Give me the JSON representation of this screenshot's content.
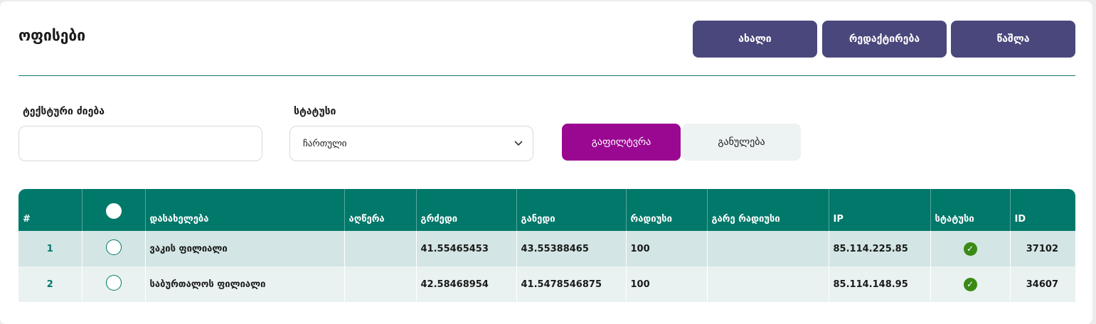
{
  "page": {
    "title": "ოფისები"
  },
  "toolbar": {
    "new_label": "ახალი",
    "edit_label": "რედაქტირება",
    "delete_label": "წაშლა"
  },
  "filters": {
    "search_label": "ტექსტური ძიება",
    "search_value": "",
    "status_label": "სტატუსი",
    "status_selected": "ჩართული",
    "filter_label": "გაფილტვრა",
    "reset_label": "განულება"
  },
  "table": {
    "columns": [
      "#",
      "",
      "დასახელება",
      "აღწერა",
      "გრძედი",
      "განედი",
      "რადიუსი",
      "გარე რადიუსი",
      "IP",
      "სტატუსი",
      "ID"
    ],
    "rows": [
      {
        "num": "1",
        "name": "ვაკის ფილიალი",
        "description": "",
        "longitude": "41.55465453",
        "latitude": "43.55388465",
        "radius": "100",
        "outer_radius": "",
        "ip": "85.114.225.85",
        "status": "active",
        "id": "37102"
      },
      {
        "num": "2",
        "name": "საბურთალოს ფილიალი",
        "description": "",
        "longitude": "42.58468954",
        "latitude": "41.5478546875",
        "radius": "100",
        "outer_radius": "",
        "ip": "85.114.148.95",
        "status": "active",
        "id": "34607"
      }
    ]
  },
  "icons": {
    "select_arrow": "chevron-down-icon",
    "status_active": "check-circle-icon",
    "row_select": "radio-icon"
  },
  "colors": {
    "primary": "#4a477c",
    "accent": "#9a0891",
    "table_header": "#00786a",
    "status_active": "#3a8a16"
  }
}
